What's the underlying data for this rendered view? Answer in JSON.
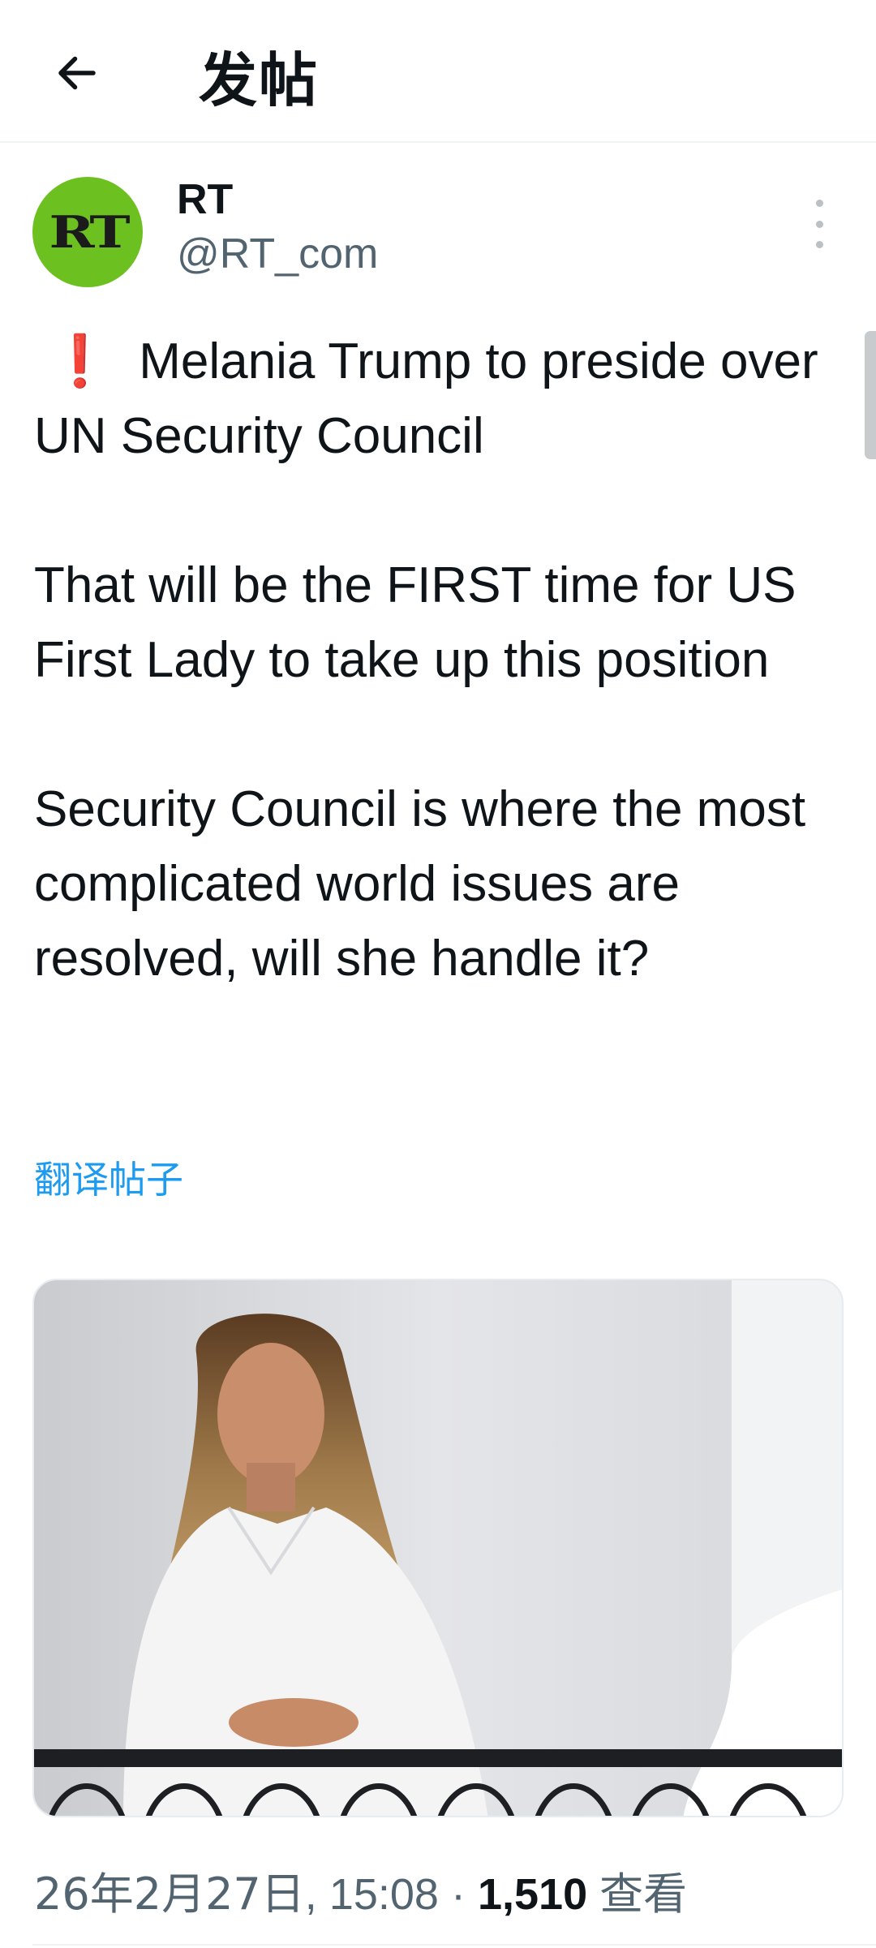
{
  "header": {
    "title": "发帖",
    "back_icon": "arrow-left-icon"
  },
  "author": {
    "avatar_text": "RT",
    "avatar_color": "#6cc01f",
    "display_name": "RT",
    "handle": "@RT_com"
  },
  "tweet": {
    "alert_icon": "❗",
    "paragraphs": [
      "Melania Trump to preside over UN Security Council",
      "That will be the FIRST time for US First Lady to take up this position",
      "Security Council is where the most complicated world issues are resolved, will she handle it?"
    ],
    "translate_label": "翻译帖子"
  },
  "meta": {
    "date": "26年2月27日",
    "time": "15:08",
    "separator": "·",
    "views_count": "1,510",
    "views_label": "查看"
  },
  "colors": {
    "accent": "#1d9bf0",
    "secondary_text": "#536471",
    "alert": "#e0245e"
  }
}
